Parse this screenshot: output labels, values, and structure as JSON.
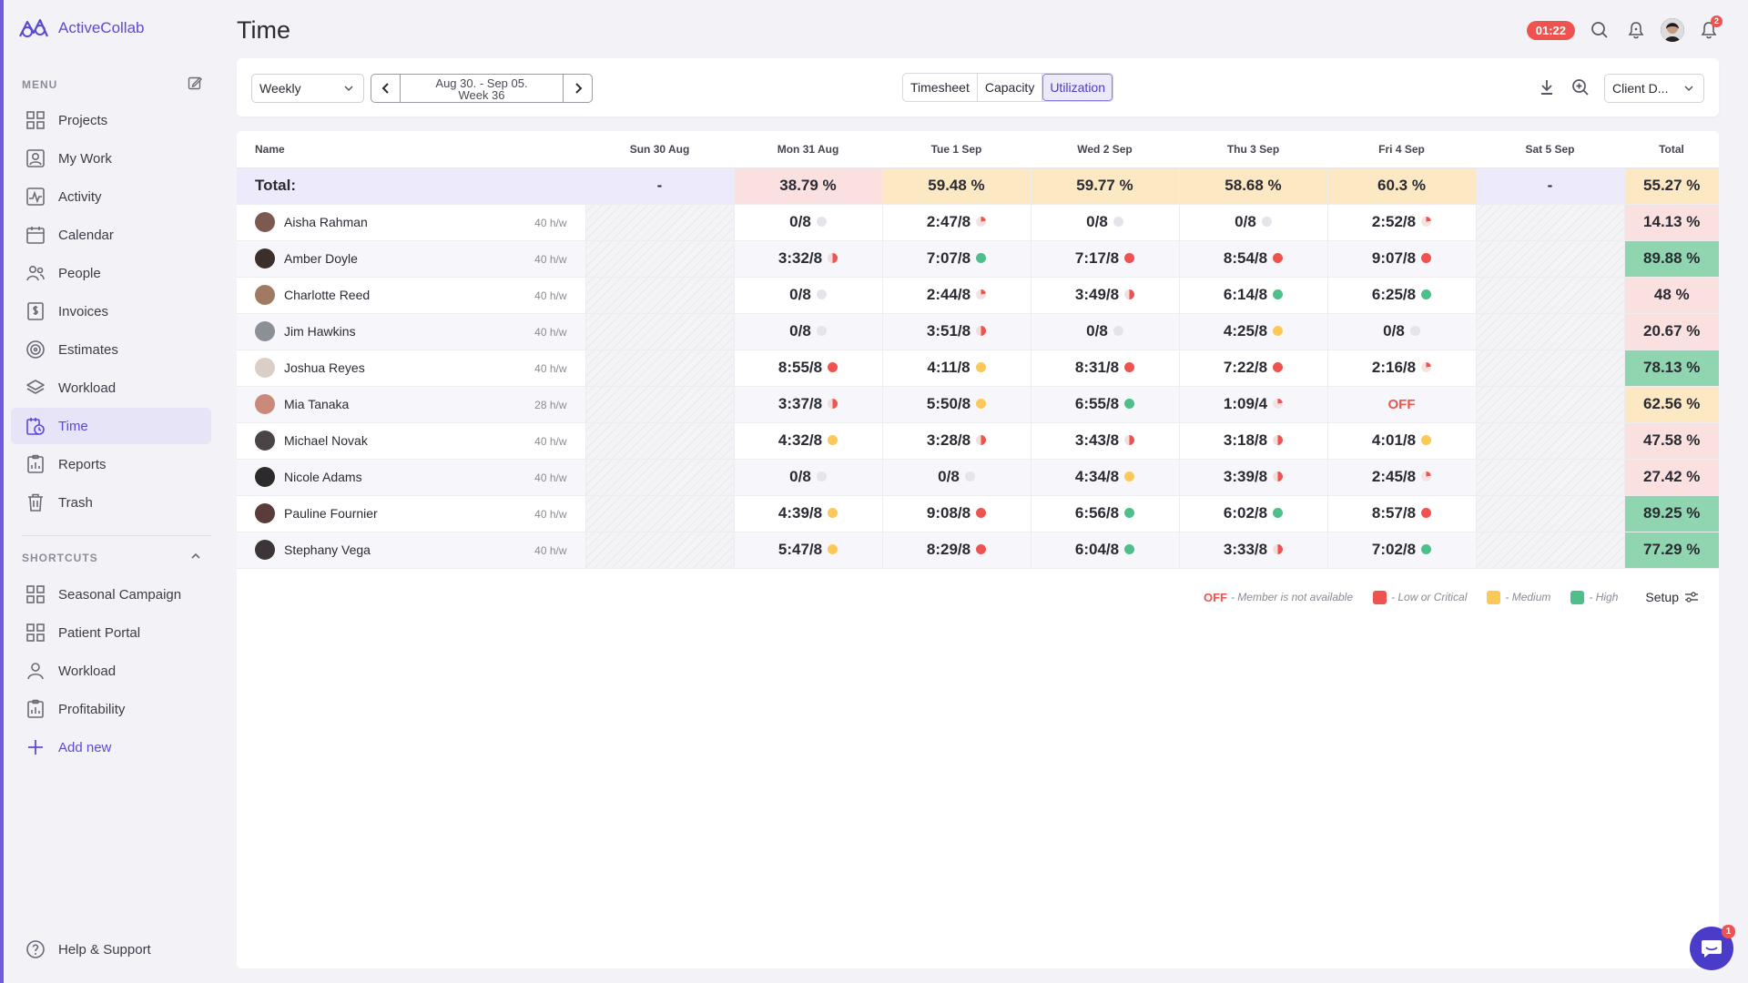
{
  "app": {
    "name": "ActiveCollab"
  },
  "sidebar": {
    "menu_label": "MENU",
    "items": [
      {
        "label": "Projects",
        "icon": "grid-icon"
      },
      {
        "label": "My Work",
        "icon": "person-card-icon"
      },
      {
        "label": "Activity",
        "icon": "activity-icon"
      },
      {
        "label": "Calendar",
        "icon": "calendar-icon"
      },
      {
        "label": "People",
        "icon": "people-icon"
      },
      {
        "label": "Invoices",
        "icon": "invoice-icon"
      },
      {
        "label": "Estimates",
        "icon": "target-icon"
      },
      {
        "label": "Workload",
        "icon": "layers-icon"
      },
      {
        "label": "Time",
        "icon": "timesheet-icon",
        "active": true
      },
      {
        "label": "Reports",
        "icon": "clipboard-icon"
      },
      {
        "label": "Trash",
        "icon": "trash-icon"
      }
    ],
    "shortcuts_label": "SHORTCUTS",
    "shortcuts": [
      {
        "label": "Seasonal Campaign",
        "icon": "grid-icon"
      },
      {
        "label": "Patient Portal",
        "icon": "grid-icon"
      },
      {
        "label": "Workload",
        "icon": "person-icon"
      },
      {
        "label": "Profitability",
        "icon": "clipboard-icon"
      }
    ],
    "add_new": "Add new",
    "help": "Help & Support"
  },
  "header": {
    "title": "Time",
    "timer": "01:22",
    "notification_count": "2"
  },
  "toolbar": {
    "period": "Weekly",
    "range_line1": "Aug 30. - Sep 05.",
    "range_line2": "Week 36",
    "tabs": [
      "Timesheet",
      "Capacity",
      "Utilization"
    ],
    "active_tab": "Utilization",
    "group_select": "Client D..."
  },
  "table": {
    "headers": [
      "Name",
      "Sun 30 Aug",
      "Mon 31 Aug",
      "Tue 1 Sep",
      "Wed 2 Sep",
      "Thu 3 Sep",
      "Fri 4 Sep",
      "Sat 5 Sep",
      "Total"
    ],
    "total": {
      "label": "Total:",
      "values": [
        "-",
        "38.79 %",
        "59.48 %",
        "59.77 %",
        "58.68 %",
        "60.3 %",
        "-",
        "55.27 %"
      ]
    },
    "rows": [
      {
        "name": "Aisha Rahman",
        "hw": "40 h/w",
        "days": [
          "0/8",
          "2:47/8",
          "0/8",
          "0/8",
          "2:52/8"
        ],
        "dots": [
          "grey",
          "lowpie",
          "grey",
          "grey",
          "lowpie"
        ],
        "total": "14.13 %",
        "level": "red"
      },
      {
        "name": "Amber Doyle",
        "hw": "40 h/w",
        "days": [
          "3:32/8",
          "7:07/8",
          "7:17/8",
          "8:54/8",
          "9:07/8"
        ],
        "dots": [
          "halfred",
          "green",
          "red",
          "red",
          "red"
        ],
        "total": "89.88 %",
        "level": "green"
      },
      {
        "name": "Charlotte Reed",
        "hw": "40 h/w",
        "days": [
          "0/8",
          "2:44/8",
          "3:49/8",
          "6:14/8",
          "6:25/8"
        ],
        "dots": [
          "grey",
          "lowpie",
          "halfred",
          "green",
          "green"
        ],
        "total": "48 %",
        "level": "red"
      },
      {
        "name": "Jim Hawkins",
        "hw": "40 h/w",
        "days": [
          "0/8",
          "3:51/8",
          "0/8",
          "4:25/8",
          "0/8"
        ],
        "dots": [
          "grey",
          "halfred",
          "grey",
          "yellow",
          "grey"
        ],
        "total": "20.67 %",
        "level": "red"
      },
      {
        "name": "Joshua Reyes",
        "hw": "40 h/w",
        "days": [
          "8:55/8",
          "4:11/8",
          "8:31/8",
          "7:22/8",
          "2:16/8"
        ],
        "dots": [
          "red",
          "yellow",
          "red",
          "red",
          "lowpie"
        ],
        "total": "78.13 %",
        "level": "green"
      },
      {
        "name": "Mia Tanaka",
        "hw": "28 h/w",
        "days": [
          "3:37/8",
          "5:50/8",
          "6:55/8",
          "1:09/4",
          "OFF"
        ],
        "dots": [
          "halfred",
          "yellow",
          "green",
          "lowpie",
          "none"
        ],
        "total": "62.56 %",
        "level": "orange"
      },
      {
        "name": "Michael Novak",
        "hw": "40 h/w",
        "days": [
          "4:32/8",
          "3:28/8",
          "3:43/8",
          "3:18/8",
          "4:01/8"
        ],
        "dots": [
          "yellow",
          "halfred",
          "halfred",
          "halfred",
          "yellow"
        ],
        "total": "47.58 %",
        "level": "red"
      },
      {
        "name": "Nicole Adams",
        "hw": "40 h/w",
        "days": [
          "0/8",
          "0/8",
          "4:34/8",
          "3:39/8",
          "2:45/8"
        ],
        "dots": [
          "grey",
          "grey",
          "yellow",
          "halfred",
          "lowpie"
        ],
        "total": "27.42 %",
        "level": "red"
      },
      {
        "name": "Pauline Fournier",
        "hw": "40 h/w",
        "days": [
          "4:39/8",
          "9:08/8",
          "6:56/8",
          "6:02/8",
          "8:57/8"
        ],
        "dots": [
          "yellow",
          "red",
          "green",
          "green",
          "red"
        ],
        "total": "89.25 %",
        "level": "green"
      },
      {
        "name": "Stephany Vega",
        "hw": "40 h/w",
        "days": [
          "5:47/8",
          "8:29/8",
          "6:04/8",
          "3:33/8",
          "7:02/8"
        ],
        "dots": [
          "yellow",
          "red",
          "green",
          "halfred",
          "green"
        ],
        "total": "77.29 %",
        "level": "green"
      }
    ]
  },
  "legend": {
    "off_label": "OFF",
    "off_text": "- Member is not available",
    "low": "- Low or Critical",
    "medium": "- Medium",
    "high": "- High",
    "setup": "Setup"
  },
  "chat": {
    "badge": "1"
  },
  "colors": {
    "accent": "#5b4ad6",
    "low": "#ef5350",
    "medium": "#fcc85a",
    "high": "#4fbf8a"
  }
}
